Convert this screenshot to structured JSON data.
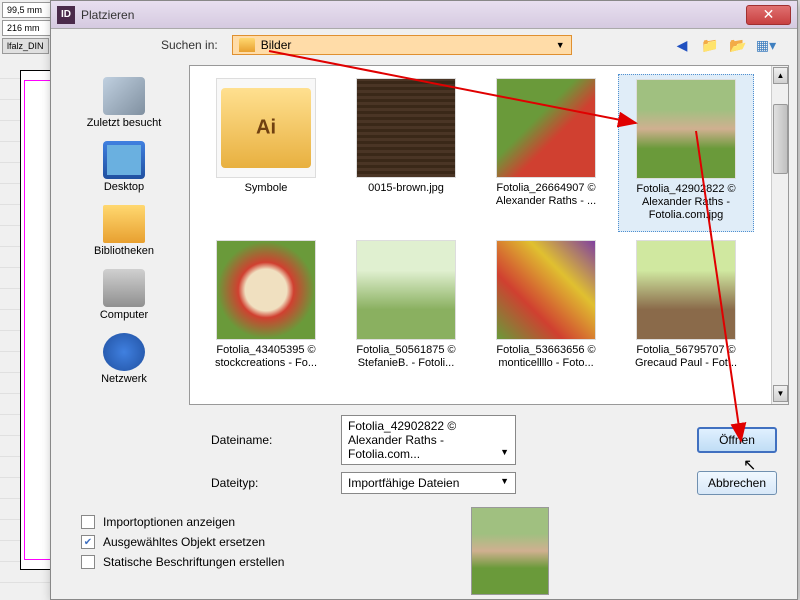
{
  "titlebar": {
    "title": "Platzieren",
    "app": "ID"
  },
  "ruler": {
    "v1": "99,5 mm",
    "v2": "216 mm",
    "tab": "lfalz_DIN"
  },
  "search": {
    "label": "Suchen in:",
    "value": "Bilder"
  },
  "sidebar": [
    {
      "label": "Zuletzt besucht"
    },
    {
      "label": "Desktop"
    },
    {
      "label": "Bibliotheken"
    },
    {
      "label": "Computer"
    },
    {
      "label": "Netzwerk"
    }
  ],
  "files": [
    {
      "label": "Symbole",
      "type": "folder"
    },
    {
      "label": "0015-brown.jpg",
      "type": "brown"
    },
    {
      "label": "Fotolia_26664907 © Alexander Raths - ...",
      "type": "veg1"
    },
    {
      "label": "Fotolia_42902822 © Alexander Raths - Fotolia.com.jpg",
      "type": "man",
      "selected": true
    },
    {
      "label": "Fotolia_43405395 © stockcreations - Fo...",
      "type": "apple"
    },
    {
      "label": "Fotolia_50561875 © StefanieB. - Fotoli...",
      "type": "asp"
    },
    {
      "label": "Fotolia_53663656 © monticellllo - Foto...",
      "type": "mix"
    },
    {
      "label": "Fotolia_56795707 © Grecaud Paul - Fot...",
      "type": "grape"
    }
  ],
  "filename": {
    "label": "Dateiname:",
    "value": "Fotolia_42902822 © Alexander Raths - Fotolia.com..."
  },
  "filetype": {
    "label": "Dateityp:",
    "value": "Importfähige Dateien"
  },
  "buttons": {
    "open": "Öffnen",
    "cancel": "Abbrechen"
  },
  "checkboxes": [
    {
      "label": "Importoptionen anzeigen",
      "checked": false
    },
    {
      "label": "Ausgewähltes Objekt ersetzen",
      "checked": true
    },
    {
      "label": "Statische Beschriftungen erstellen",
      "checked": false
    }
  ]
}
